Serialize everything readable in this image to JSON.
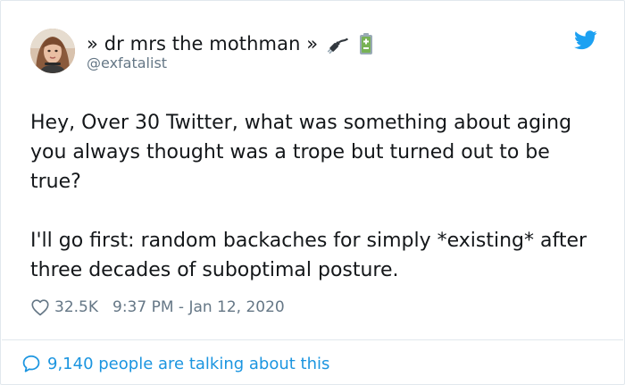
{
  "tweet": {
    "author": {
      "display_name": "» dr mrs the mothman »",
      "handle": "@exfatalist",
      "emoji_1": "electric-plug-icon",
      "emoji_2": "battery-icon"
    },
    "text_paragraphs": [
      "Hey, Over 30 Twitter, what was something about aging you always thought was a trope but turned out to be true?",
      "I'll go first: random backaches for simply *existing* after three decades of suboptimal posture."
    ],
    "like_count": "32.5K",
    "timestamp": "9:37 PM - Jan 12, 2020",
    "conversation_text": "9,140 people are talking about this"
  },
  "colors": {
    "twitter_blue": "#1da1f2",
    "link_blue": "#1b95e0",
    "secondary_gray": "#657786",
    "text_dark": "#14171a",
    "border": "#e1e8ed",
    "battery_green": "#77b255"
  },
  "icons": {
    "logo": "twitter-bird-icon",
    "like": "heart-icon",
    "conversation": "speech-bubble-icon"
  }
}
